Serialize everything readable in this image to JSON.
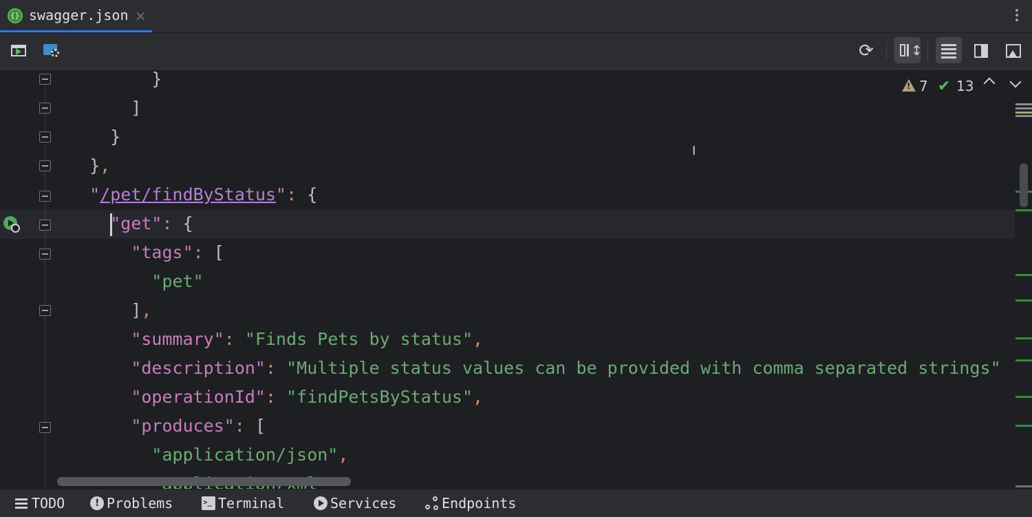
{
  "tab": {
    "file_name": "swagger.json",
    "close_glyph": "×",
    "icon": "json-file-icon"
  },
  "toolbar": {
    "icons": [
      "run-icon",
      "swagger-folder-icon",
      "refresh-icon",
      "editor-and-preview-icon",
      "editor-only-icon",
      "preview-panel-icon",
      "image-preview-icon"
    ]
  },
  "inspections": {
    "warnings": "7",
    "weak_warnings": "13"
  },
  "code": [
    {
      "indent": "        ",
      "tokens": [
        {
          "t": "}",
          "c": "p"
        }
      ]
    },
    {
      "indent": "      ",
      "tokens": [
        {
          "t": "]",
          "c": "p"
        }
      ]
    },
    {
      "indent": "    ",
      "tokens": [
        {
          "t": "}",
          "c": "p"
        }
      ]
    },
    {
      "indent": "  ",
      "tokens": [
        {
          "t": "}",
          "c": "p"
        },
        {
          "t": ",",
          "c": "o"
        }
      ]
    },
    {
      "indent": "  ",
      "tokens": [
        {
          "t": "\"",
          "c": "k"
        },
        {
          "t": "/pet/findByStatus",
          "c": "u"
        },
        {
          "t": "\"",
          "c": "k"
        },
        {
          "t": ": ",
          "c": "o"
        },
        {
          "t": "{",
          "c": "p"
        }
      ]
    },
    {
      "indent": "    ",
      "tokens": [
        {
          "t": "\"get\"",
          "c": "k"
        },
        {
          "t": ": ",
          "c": "o"
        },
        {
          "t": "{",
          "c": "p"
        }
      ]
    },
    {
      "indent": "      ",
      "tokens": [
        {
          "t": "\"tags\"",
          "c": "k"
        },
        {
          "t": ": ",
          "c": "o"
        },
        {
          "t": "[",
          "c": "p"
        }
      ]
    },
    {
      "indent": "        ",
      "tokens": [
        {
          "t": "\"pet\"",
          "c": "s"
        }
      ]
    },
    {
      "indent": "      ",
      "tokens": [
        {
          "t": "]",
          "c": "p"
        },
        {
          "t": ",",
          "c": "o"
        }
      ]
    },
    {
      "indent": "      ",
      "tokens": [
        {
          "t": "\"summary\"",
          "c": "k"
        },
        {
          "t": ": ",
          "c": "o"
        },
        {
          "t": "\"Finds Pets by status\"",
          "c": "s"
        },
        {
          "t": ",",
          "c": "o"
        }
      ]
    },
    {
      "indent": "      ",
      "tokens": [
        {
          "t": "\"description\"",
          "c": "k"
        },
        {
          "t": ": ",
          "c": "o"
        },
        {
          "t": "\"Multiple status values can be provided with comma separated strings\"",
          "c": "s"
        }
      ]
    },
    {
      "indent": "      ",
      "tokens": [
        {
          "t": "\"operationId\"",
          "c": "k"
        },
        {
          "t": ": ",
          "c": "o"
        },
        {
          "t": "\"findPetsByStatus\"",
          "c": "s"
        },
        {
          "t": ",",
          "c": "o"
        }
      ]
    },
    {
      "indent": "      ",
      "tokens": [
        {
          "t": "\"produces\"",
          "c": "k"
        },
        {
          "t": ": ",
          "c": "o"
        },
        {
          "t": "[",
          "c": "p"
        }
      ]
    },
    {
      "indent": "        ",
      "tokens": [
        {
          "t": "\"application/json\"",
          "c": "s"
        },
        {
          "t": ",",
          "c": "o"
        }
      ]
    },
    {
      "indent": "        ",
      "tokens": [
        {
          "t": "\"application/xml\"",
          "c": "s"
        }
      ]
    }
  ],
  "bottom_bar": {
    "todo": "TODO",
    "problems": "Problems",
    "terminal": "Terminal",
    "services": "Services",
    "endpoints": "Endpoints"
  },
  "colors": {
    "background": "#1e1f22",
    "panel": "#2b2d30",
    "accent": "#3574f0",
    "key": "#c77dbb",
    "string": "#6aab73",
    "punctuation": "#cf8e6d"
  }
}
